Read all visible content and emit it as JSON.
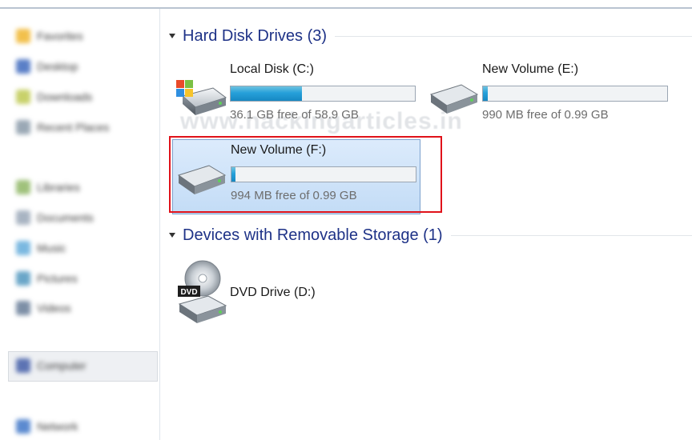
{
  "window": {
    "top_border": ""
  },
  "navigation": {
    "items": [
      {
        "label": "Favorites",
        "color": "#f2c04c"
      },
      {
        "label": "Desktop",
        "color": "#5a7fc7"
      },
      {
        "label": "Downloads",
        "color": "#c8d16a"
      },
      {
        "label": "Recent Places",
        "color": "#9aa8b5"
      },
      {
        "label": "Libraries",
        "color": "#9fc17b"
      },
      {
        "label": "Documents",
        "color": "#a8b4c2"
      },
      {
        "label": "Music",
        "color": "#7ab8e0"
      },
      {
        "label": "Pictures",
        "color": "#6aa6c8"
      },
      {
        "label": "Videos",
        "color": "#7d8fa6"
      },
      {
        "label": "Computer",
        "color": "#5c73b3"
      },
      {
        "label": "Network",
        "color": "#5b8ad0"
      }
    ]
  },
  "watermark": "www.hackingarticles.in",
  "groups": {
    "hard_disks": {
      "title": "Hard Disk Drives (3)"
    },
    "removable": {
      "title": "Devices with Removable Storage (1)"
    }
  },
  "drives": {
    "c": {
      "name": "Local Disk (C:)",
      "free_text": "36.1 GB free of 58.9 GB",
      "used_fraction": 0.387
    },
    "e": {
      "name": "New Volume (E:)",
      "free_text": "990 MB free of 0.99 GB",
      "used_fraction": 0.025
    },
    "f": {
      "name": "New Volume (F:)",
      "free_text": "994 MB free of 0.99 GB",
      "used_fraction": 0.02
    },
    "d": {
      "name": "DVD Drive (D:)",
      "badge": "DVD"
    }
  },
  "colors": {
    "accent_title": "#1e3287",
    "selection_outline": "#e0121a",
    "bar_fill": "#26a0da"
  }
}
